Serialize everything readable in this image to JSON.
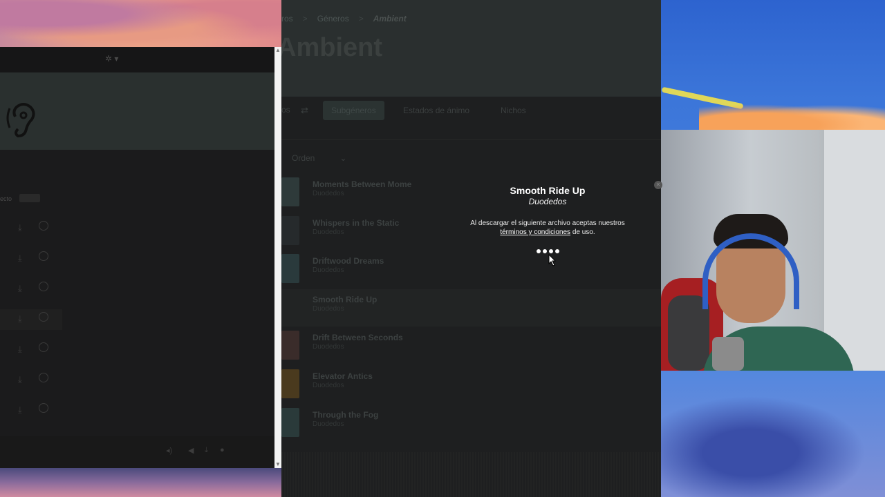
{
  "left_window": {
    "list_label": "ecto",
    "row_count": 7
  },
  "browser": {
    "breadcrumb": [
      "Géneros",
      "Ambient"
    ],
    "breadcrumb_partial": "ros",
    "page_title": "Ambient",
    "tabs": {
      "prev": "os",
      "subgeneros": "Subgéneros",
      "estados": "Estados de ánimo",
      "nichos": "Nichos"
    },
    "sort_label": "Orden",
    "tracks": [
      {
        "title": "Moments Between Mome",
        "artist": "Duodedos",
        "color": "#2e3a3a"
      },
      {
        "title": "Whispers in the Static",
        "artist": "Duodedos",
        "color": "#262a2c"
      },
      {
        "title": "Driftwood Dreams",
        "artist": "Duodedos",
        "color": "#2a3a3c"
      },
      {
        "title": "Smooth Ride Up",
        "artist": "Duodedos",
        "color": "#222424"
      },
      {
        "title": "Drift Between Seconds",
        "artist": "Duodedos",
        "color": "#3a2c2a"
      },
      {
        "title": "Elevator Antics",
        "artist": "Duodedos",
        "color": "#4a3a1e"
      },
      {
        "title": "Through the Fog",
        "artist": "Duodedos",
        "color": "#2a3a3a"
      }
    ]
  },
  "modal": {
    "title": "Smooth Ride Up",
    "artist": "Duodedos",
    "text_before": "Al descargar el siguiente archivo aceptas nuestros ",
    "link_text": "términos y condiciones",
    "text_after": " de uso."
  }
}
